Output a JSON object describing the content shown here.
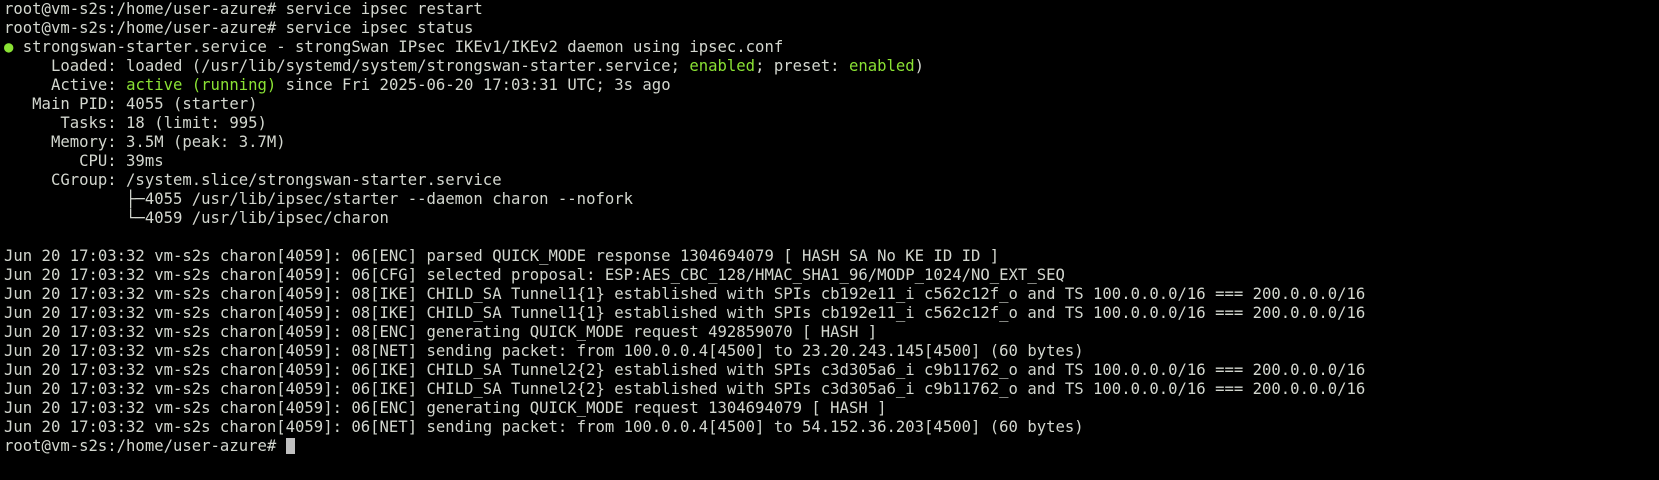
{
  "terminal": {
    "prompt": "root@vm-s2s:/home/user-azure#",
    "cmd1": " service ipsec restart",
    "cmd2": " service ipsec status",
    "status_dot": "●",
    "unit_line": " strongswan-starter.service - strongSwan IPsec IKEv1/IKEv2 daemon using ipsec.conf",
    "loaded_pre": "     Loaded: loaded (/usr/lib/systemd/system/strongswan-starter.service; ",
    "loaded_enabled": "enabled",
    "loaded_mid": "; preset: ",
    "loaded_preset": "enabled",
    "loaded_post": ")",
    "active_pre": "     Active: ",
    "active_state": "active (running)",
    "active_post": " since Fri 2025-06-20 17:03:31 UTC; 3s ago",
    "main_pid": "   Main PID: 4055 (starter)",
    "tasks": "      Tasks: 18 (limit: 995)",
    "memory": "     Memory: 3.5M (peak: 3.7M)",
    "cpu": "        CPU: 39ms",
    "cgroup": "     CGroup: /system.slice/strongswan-starter.service",
    "cgroup_child1": "             ├─4055 /usr/lib/ipsec/starter --daemon charon --nofork",
    "cgroup_child2": "             └─4059 /usr/lib/ipsec/charon",
    "logs": [
      "Jun 20 17:03:32 vm-s2s charon[4059]: 06[ENC] parsed QUICK_MODE response 1304694079 [ HASH SA No KE ID ID ]",
      "Jun 20 17:03:32 vm-s2s charon[4059]: 06[CFG] selected proposal: ESP:AES_CBC_128/HMAC_SHA1_96/MODP_1024/NO_EXT_SEQ",
      "Jun 20 17:03:32 vm-s2s charon[4059]: 08[IKE] CHILD_SA Tunnel1{1} established with SPIs cb192e11_i c562c12f_o and TS 100.0.0.0/16 === 200.0.0.0/16",
      "Jun 20 17:03:32 vm-s2s charon[4059]: 08[IKE] CHILD_SA Tunnel1{1} established with SPIs cb192e11_i c562c12f_o and TS 100.0.0.0/16 === 200.0.0.0/16",
      "Jun 20 17:03:32 vm-s2s charon[4059]: 08[ENC] generating QUICK_MODE request 492859070 [ HASH ]",
      "Jun 20 17:03:32 vm-s2s charon[4059]: 08[NET] sending packet: from 100.0.0.4[4500] to 23.20.243.145[4500] (60 bytes)",
      "Jun 20 17:03:32 vm-s2s charon[4059]: 06[IKE] CHILD_SA Tunnel2{2} established with SPIs c3d305a6_i c9b11762_o and TS 100.0.0.0/16 === 200.0.0.0/16",
      "Jun 20 17:03:32 vm-s2s charon[4059]: 06[IKE] CHILD_SA Tunnel2{2} established with SPIs c3d305a6_i c9b11762_o and TS 100.0.0.0/16 === 200.0.0.0/16",
      "Jun 20 17:03:32 vm-s2s charon[4059]: 06[ENC] generating QUICK_MODE request 1304694079 [ HASH ]",
      "Jun 20 17:03:32 vm-s2s charon[4059]: 06[NET] sending packet: from 100.0.0.4[4500] to 54.152.36.203[4500] (60 bytes)"
    ],
    "colors": {
      "background": "#000000",
      "foreground": "#d3d7cf",
      "green": "#8ae234"
    }
  }
}
